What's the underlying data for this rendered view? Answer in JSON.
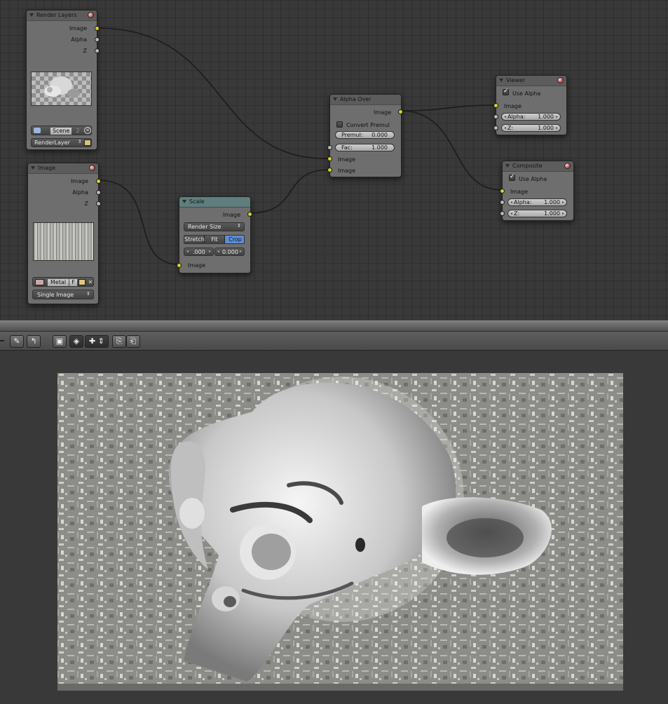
{
  "nodes": {
    "render_layers": {
      "title": "Render Layers",
      "outputs": [
        "Image",
        "Alpha",
        "Z"
      ],
      "scene_label": "Scene",
      "scene_users": "2",
      "layer_label": "RenderLayer"
    },
    "image": {
      "title": "Image",
      "outputs": [
        "Image",
        "Alpha",
        "Z"
      ],
      "image_name": "Metal",
      "fake_user": "F",
      "source": "Single Image"
    },
    "scale": {
      "title": "Scale",
      "output": "Image",
      "space": "Render Size",
      "modes": [
        "Stretch",
        "Fit",
        "Crop"
      ],
      "active_mode": "Crop",
      "offset_x": ".000",
      "offset_y": "0.000",
      "input": "Image"
    },
    "alpha_over": {
      "title": "Alpha Over",
      "output": "Image",
      "convert_premul": "Convert Premul",
      "premul_label": "Premul:",
      "premul_value": "0.000",
      "fac_label": "Fac:",
      "fac_value": "1.000",
      "inputs": [
        "Image",
        "Image"
      ]
    },
    "viewer": {
      "title": "Viewer",
      "use_alpha": "Use Alpha",
      "input": "Image",
      "alpha_label": "Alpha:",
      "alpha_value": "1.000",
      "z_label": "Z:",
      "z_value": "1.000"
    },
    "composite": {
      "title": "Composite",
      "use_alpha": "Use Alpha",
      "input": "Image",
      "alpha_label": "Alpha:",
      "alpha_value": "1.000",
      "z_label": "Z:",
      "z_value": "1.000"
    }
  },
  "toolbar": {
    "icons": [
      "pin-icon",
      "parent-up-icon",
      "render-icon",
      "texture-icon",
      "backdrop-move-icon",
      "copy-icon",
      "paste-icon"
    ]
  },
  "colors": {
    "socket_color": "#d8d02a",
    "active_button": "#5b8fd6",
    "grid_background": "#393939"
  }
}
